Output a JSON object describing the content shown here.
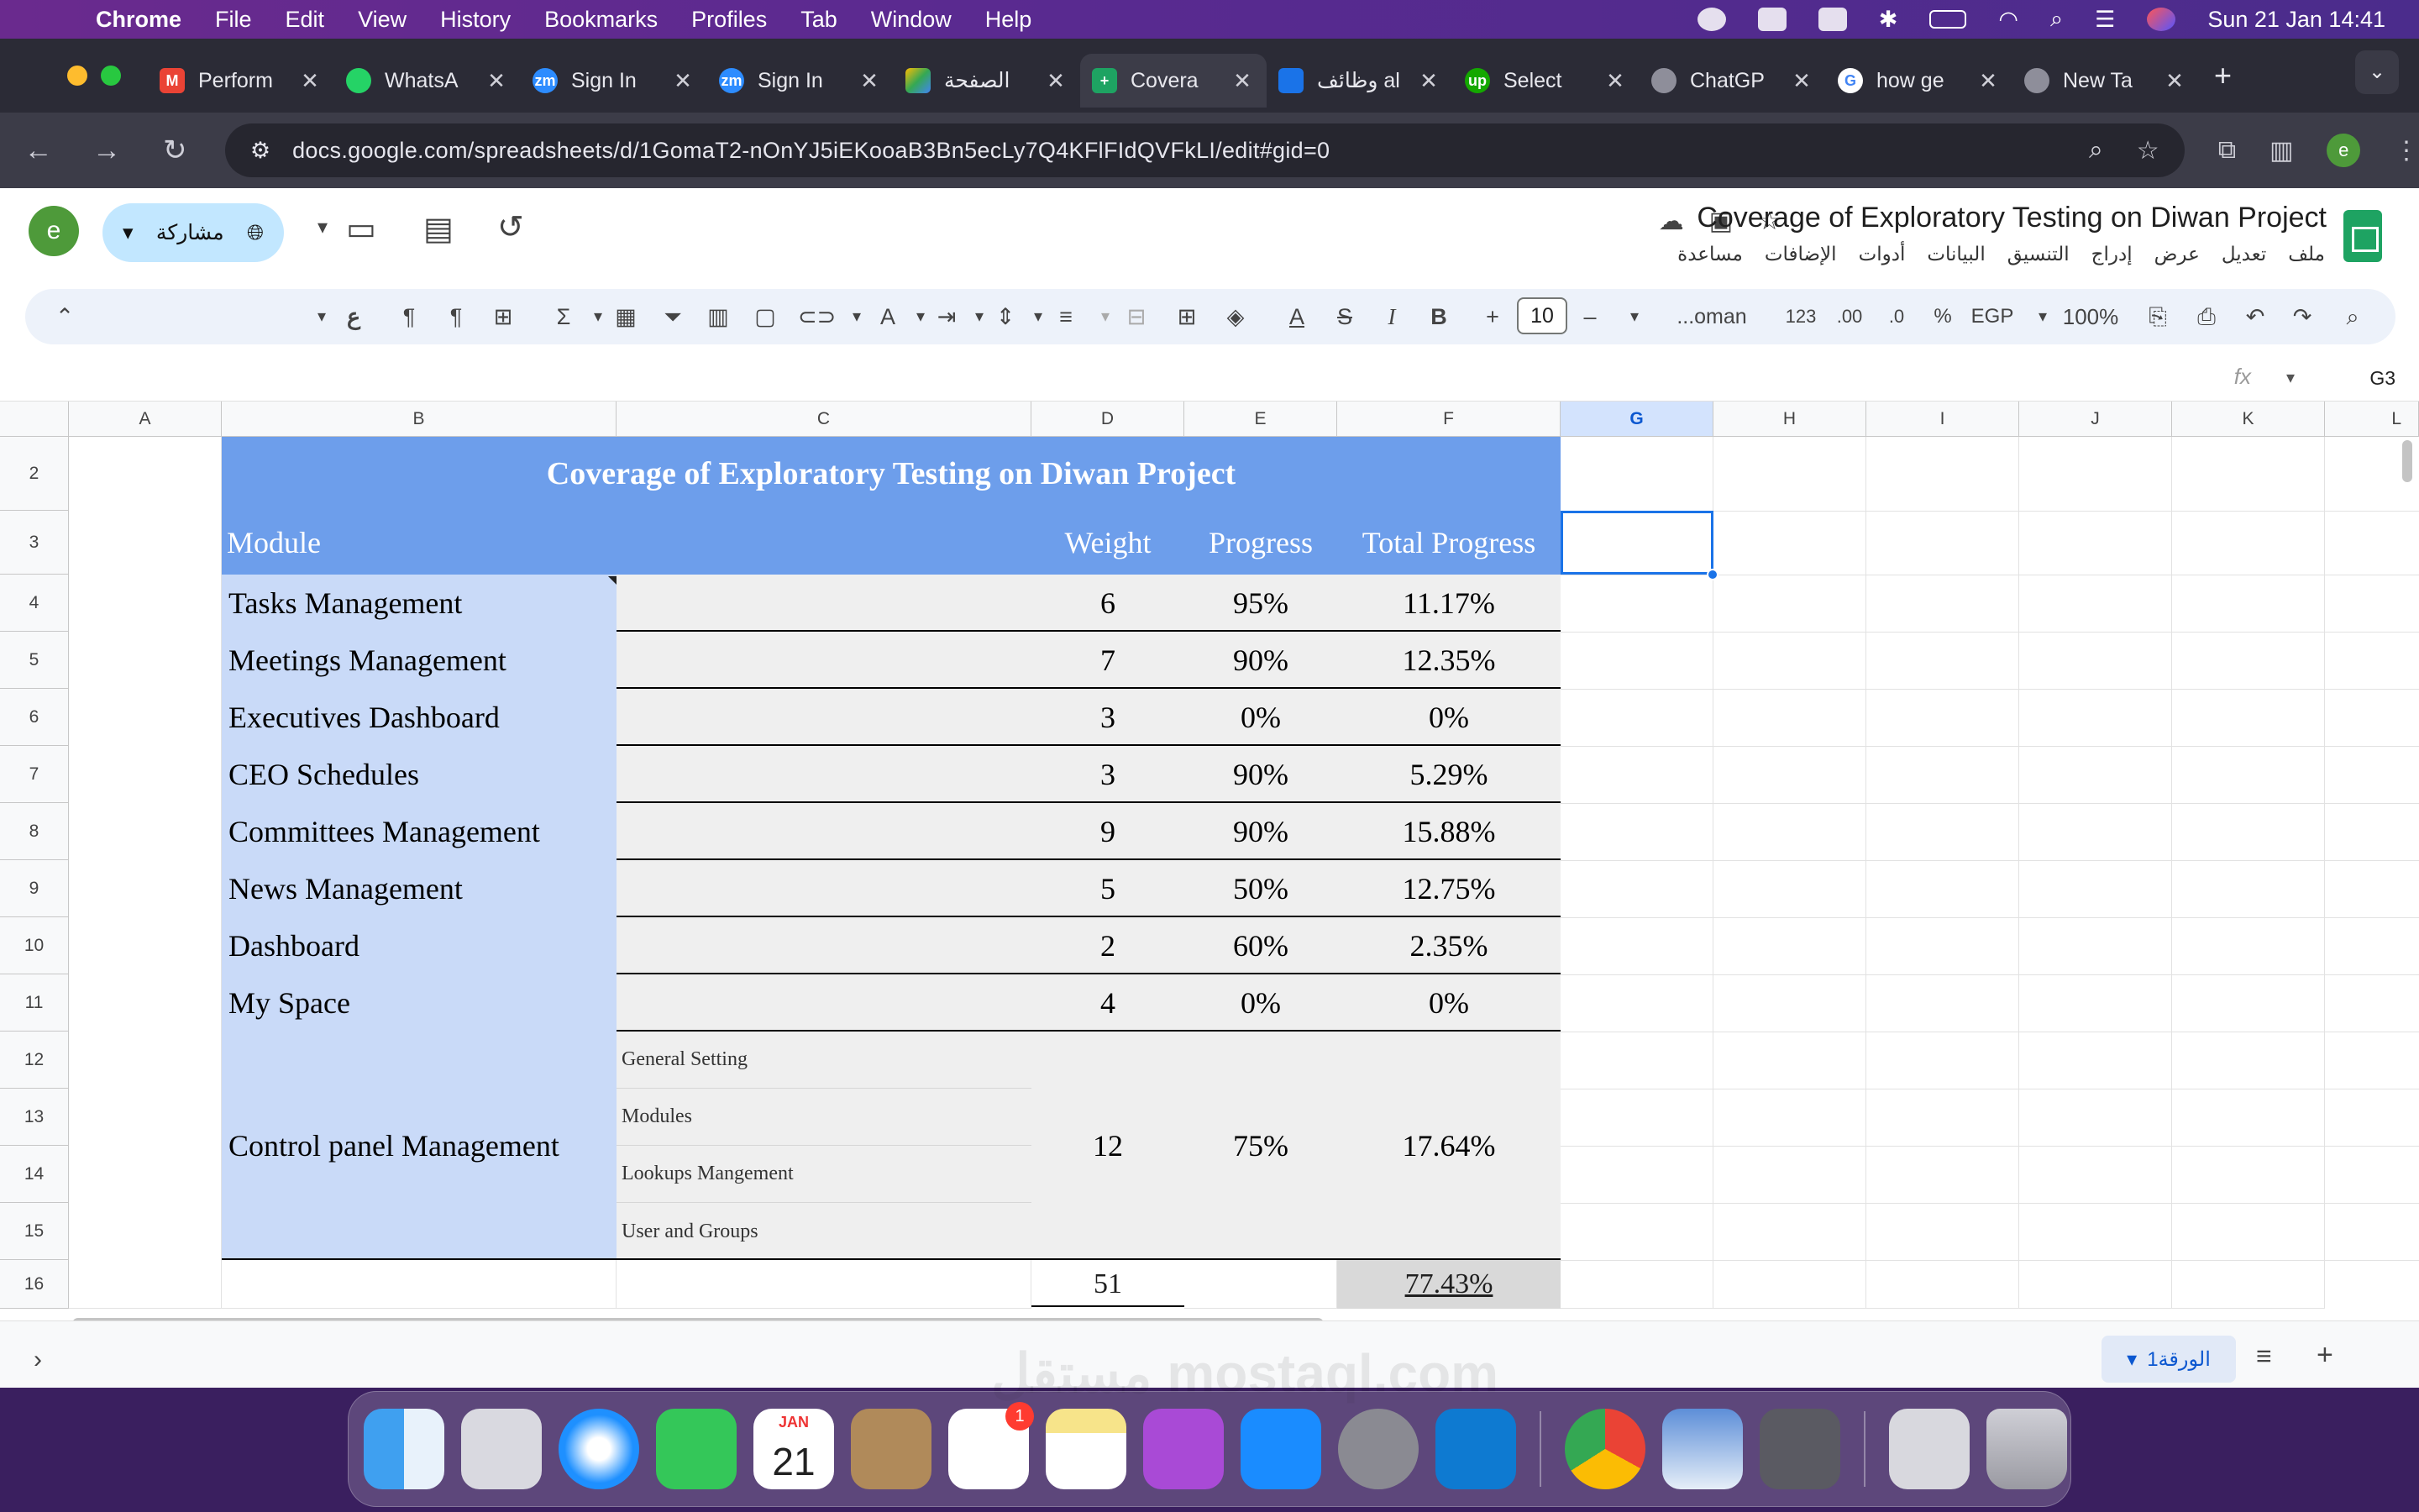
{
  "menubar": {
    "app": "Chrome",
    "items": [
      "File",
      "Edit",
      "View",
      "History",
      "Bookmarks",
      "Profiles",
      "Tab",
      "Window",
      "Help"
    ],
    "datetime": "Sun 21 Jan  14:41"
  },
  "tabs": [
    {
      "label": "Perform",
      "icon": "gmail-icon",
      "color": "#ea4335"
    },
    {
      "label": "WhatsA",
      "icon": "whatsapp-icon",
      "color": "#25d366"
    },
    {
      "label": "Sign In",
      "icon": "zoom-icon",
      "color": "#2d8cff"
    },
    {
      "label": "Sign In",
      "icon": "zoom-icon",
      "color": "#2d8cff"
    },
    {
      "label": "الصفحة",
      "icon": "drive-icon",
      "color": "#fbbc04"
    },
    {
      "label": "Covera",
      "icon": "sheets-icon",
      "color": "#1ea362"
    },
    {
      "label": "وظائف al",
      "icon": "site-icon",
      "color": "#1a73e8"
    },
    {
      "label": "Select",
      "icon": "upwork-icon",
      "color": "#14a800"
    },
    {
      "label": "ChatGP",
      "icon": "chatgpt-icon",
      "color": "#8e8e9a"
    },
    {
      "label": "how ge",
      "icon": "google-icon",
      "color": "#ffffff"
    },
    {
      "label": "New Ta",
      "icon": "chrome-icon",
      "color": "#8e8e9a"
    }
  ],
  "omnibox": {
    "url": "docs.google.com/spreadsheets/d/1GomaT2-nOnYJ5iEKooaB3Bn5ecLy7Q4KFlFIdQVFkLI/edit#gid=0"
  },
  "profile_letter": "e",
  "doc": {
    "title": "Coverage of Exploratory Testing on Diwan Project",
    "share_label": "مشاركة",
    "menu": [
      "ملف",
      "تعديل",
      "عرض",
      "إدراج",
      "التنسيق",
      "البيانات",
      "أدوات",
      "الإضافات",
      "مساعدة"
    ]
  },
  "toolbar": {
    "zoom": "100%",
    "currency": "EGP",
    "percent": "%",
    "fmt_123": "123",
    "font": "...oman",
    "font_size": "10"
  },
  "formula": {
    "cell_ref": "G3",
    "fx": "fx"
  },
  "columns": [
    "A",
    "B",
    "C",
    "D",
    "E",
    "F",
    "G",
    "H",
    "I",
    "J",
    "K",
    "L"
  ],
  "rows": [
    "2",
    "3",
    "4",
    "5",
    "6",
    "7",
    "8",
    "9",
    "10",
    "11",
    "12",
    "13",
    "14",
    "15",
    "16"
  ],
  "sheet": {
    "title": "Coverage of Exploratory Testing on Diwan Project",
    "headers": {
      "module": "Module",
      "weight": "Weight",
      "progress": "Progress",
      "total": "Total Progress"
    },
    "modules": [
      {
        "name": "Tasks Management",
        "weight": "6",
        "progress": "95%",
        "total": "11.17%"
      },
      {
        "name": "Meetings Management",
        "weight": "7",
        "progress": "90%",
        "total": "12.35%"
      },
      {
        "name": "Executives Dashboard",
        "weight": "3",
        "progress": "0%",
        "total": "0%"
      },
      {
        "name": "CEO Schedules",
        "weight": "3",
        "progress": "90%",
        "total": "5.29%"
      },
      {
        "name": "Committees Management",
        "weight": "9",
        "progress": "90%",
        "total": "15.88%"
      },
      {
        "name": "News Management",
        "weight": "5",
        "progress": "50%",
        "total": "12.75%"
      },
      {
        "name": "Dashboard",
        "weight": "2",
        "progress": "60%",
        "total": "2.35%"
      },
      {
        "name": "My Space",
        "weight": "4",
        "progress": "0%",
        "total": "0%"
      }
    ],
    "control_panel": {
      "name": "Control panel Management",
      "subs": [
        "General Setting",
        "Modules",
        "Lookups Mangement",
        "User and Groups"
      ],
      "weight": "12",
      "progress": "75%",
      "total": "17.64%"
    },
    "sum_weight": "51",
    "sum_total": "77.43%"
  },
  "sheet_tab": "الورقة1",
  "dock": {
    "calendar_month": "JAN",
    "calendar_day": "21",
    "reminders_badge": "1"
  },
  "watermark": "مستقل mostaql.com"
}
